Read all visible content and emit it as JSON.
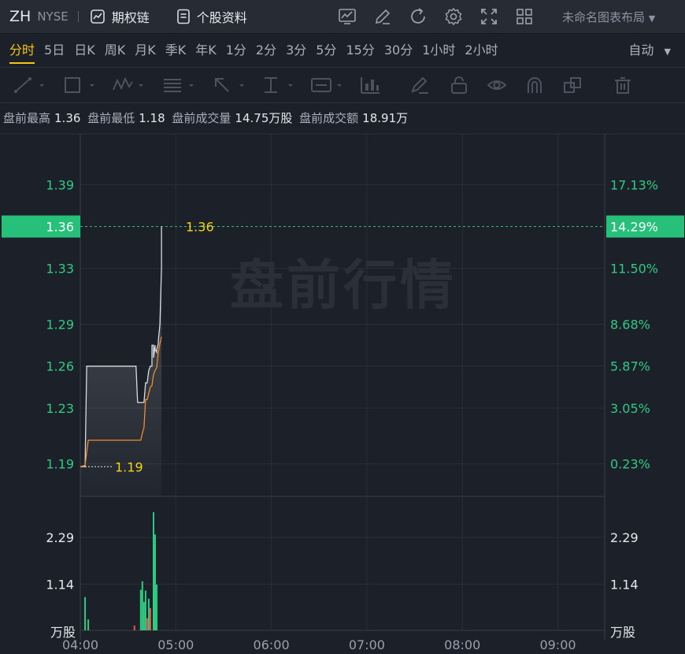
{
  "header": {
    "symbol": "ZH",
    "exchange": "NYSE",
    "options_chain_label": "期权链",
    "stock_profile_label": "个股资料",
    "layout_label": "未命名图表布局"
  },
  "periods": {
    "items": [
      "分时",
      "5日",
      "日K",
      "周K",
      "月K",
      "季K",
      "年K",
      "1分",
      "2分",
      "3分",
      "5分",
      "15分",
      "30分",
      "1小时",
      "2小时"
    ],
    "active": 0,
    "mode_label": "自动"
  },
  "drawing_tools": [
    "line-tool-icon",
    "rectangle-tool-icon",
    "wave-tool-icon",
    "fib-tool-icon",
    "arrow-tool-icon",
    "text-bar-tool-icon",
    "label-tool-icon",
    "bar-pattern-tool-icon",
    "brush-tool-icon",
    "lock-icon",
    "eye-icon",
    "magnet-icon",
    "clone-icon",
    "trash-icon"
  ],
  "premarket_stats": {
    "high_label": "盘前最高",
    "high": "1.36",
    "low_label": "盘前最低",
    "low": "1.18",
    "volume_label": "盘前成交量",
    "volume": "14.75万股",
    "turnover_label": "盘前成交额",
    "turnover": "18.91万"
  },
  "colors": {
    "up": "#2fcb82",
    "down": "#e5574b",
    "price_line": "#d8dbe0",
    "avg_line": "#f08c2c",
    "label_yellow": "#f5d416",
    "current_badge": "#26c07a"
  },
  "chart_data": {
    "type": "line",
    "watermark": "盘前行情",
    "x_ticks": [
      "04:00",
      "05:00",
      "06:00",
      "07:00",
      "08:00",
      "09:00"
    ],
    "xlim": [
      "04:00",
      "09:30"
    ],
    "price_ticks": [
      "1.39",
      "1.36",
      "1.33",
      "1.29",
      "1.26",
      "1.23",
      "1.19"
    ],
    "pct_ticks": [
      "17.13%",
      "14.29%",
      "11.50%",
      "8.68%",
      "5.87%",
      "3.05%",
      "0.23%"
    ],
    "ylim": [
      1.1667,
      1.4263
    ],
    "current_price": "1.36",
    "current_pct": "14.29%",
    "high_label": "1.36",
    "low_label": "1.19",
    "price_series": {
      "x": [
        "04:00",
        "04:02",
        "04:03",
        "04:04",
        "04:05",
        "04:35",
        "04:36",
        "04:40",
        "04:41",
        "04:42",
        "04:43",
        "04:44",
        "04:45",
        "04:45",
        "04:46",
        "04:46",
        "04:47",
        "04:47",
        "04:48",
        "04:48",
        "04:49",
        "04:49",
        "04:50",
        "04:51",
        "04:51"
      ],
      "y": [
        1.188,
        1.188,
        1.188,
        1.26,
        1.26,
        1.26,
        1.234,
        1.234,
        1.248,
        1.248,
        1.257,
        1.26,
        1.26,
        1.275,
        1.275,
        1.266,
        1.275,
        1.272,
        1.27,
        1.272,
        1.276,
        1.278,
        1.29,
        1.33,
        1.36
      ]
    },
    "avg_series": {
      "x": [
        "04:00",
        "04:03",
        "04:05",
        "04:38",
        "04:39",
        "04:40",
        "04:41",
        "04:42",
        "04:44",
        "04:45",
        "04:46",
        "04:47",
        "04:48",
        "04:49",
        "04:50",
        "04:51"
      ],
      "y": [
        1.188,
        1.189,
        1.207,
        1.207,
        1.212,
        1.216,
        1.236,
        1.236,
        1.245,
        1.246,
        1.254,
        1.257,
        1.259,
        1.27,
        1.276,
        1.281
      ]
    },
    "volume": {
      "ticks": [
        "2.29",
        "1.14"
      ],
      "unit": "万股",
      "ylim": [
        0,
        3.3
      ],
      "bars": [
        {
          "t": "04:03",
          "v": 0.82,
          "dir": "up"
        },
        {
          "t": "04:05",
          "v": 0.27,
          "dir": "up"
        },
        {
          "t": "04:34",
          "v": 0.12,
          "dir": "down"
        },
        {
          "t": "04:38",
          "v": 1.0,
          "dir": "up"
        },
        {
          "t": "04:39",
          "v": 1.21,
          "dir": "up"
        },
        {
          "t": "04:40",
          "v": 0.7,
          "dir": "up"
        },
        {
          "t": "04:41",
          "v": 0.98,
          "dir": "up"
        },
        {
          "t": "04:42",
          "v": 0.3,
          "dir": "down"
        },
        {
          "t": "04:43",
          "v": 0.78,
          "dir": "up"
        },
        {
          "t": "04:44",
          "v": 0.55,
          "dir": "down"
        },
        {
          "t": "04:46",
          "v": 2.91,
          "dir": "up"
        },
        {
          "t": "04:47",
          "v": 2.36,
          "dir": "up"
        },
        {
          "t": "04:48",
          "v": 1.13,
          "dir": "up"
        }
      ]
    }
  }
}
